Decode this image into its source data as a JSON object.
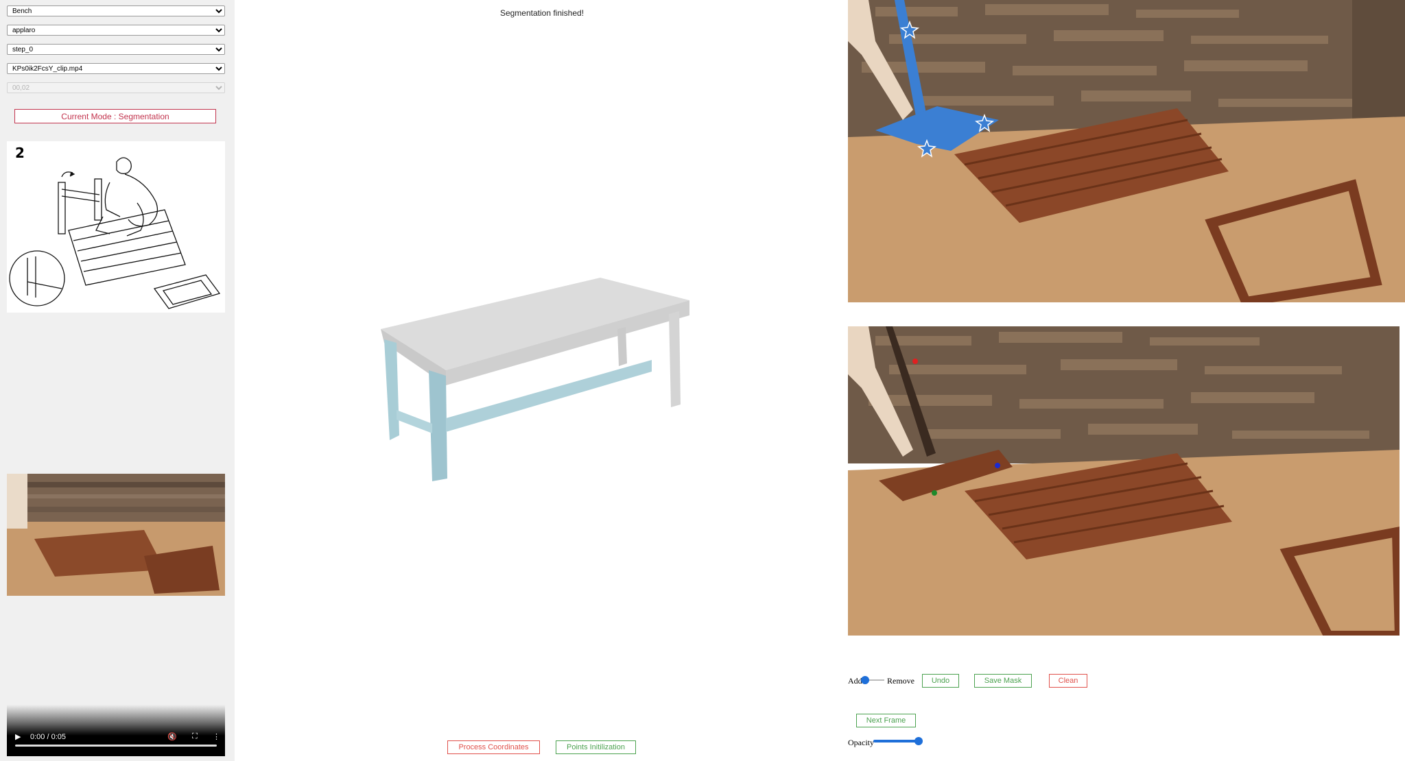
{
  "sidebar": {
    "category_select": "Bench",
    "furniture_select": "applaro",
    "step_select": "step_0",
    "video_select": "KPs0ik2FcsY_clip.mp4",
    "time_select": "00,02",
    "mode_button": "Current Mode : Segmentation",
    "manual_step_number": "2",
    "player": {
      "time": "0:00 / 0:05"
    }
  },
  "center": {
    "status": "Segmentation finished!",
    "process_button": "Process Coordinates",
    "points_button": "Points Initilization"
  },
  "right": {
    "add_label": "Add",
    "remove_label": "Remove",
    "undo_button": "Undo",
    "save_mask_button": "Save Mask",
    "clean_button": "Clean",
    "next_frame_button": "Next Frame",
    "opacity_label": "Opacity",
    "opacity_value": 1.0
  },
  "colors": {
    "accent_blue": "#1e6fd9",
    "mask_blue": "#3b7fd3",
    "red_button": "#e0504a",
    "green_button": "#4aa14e",
    "mode_button": "#c2334d"
  }
}
